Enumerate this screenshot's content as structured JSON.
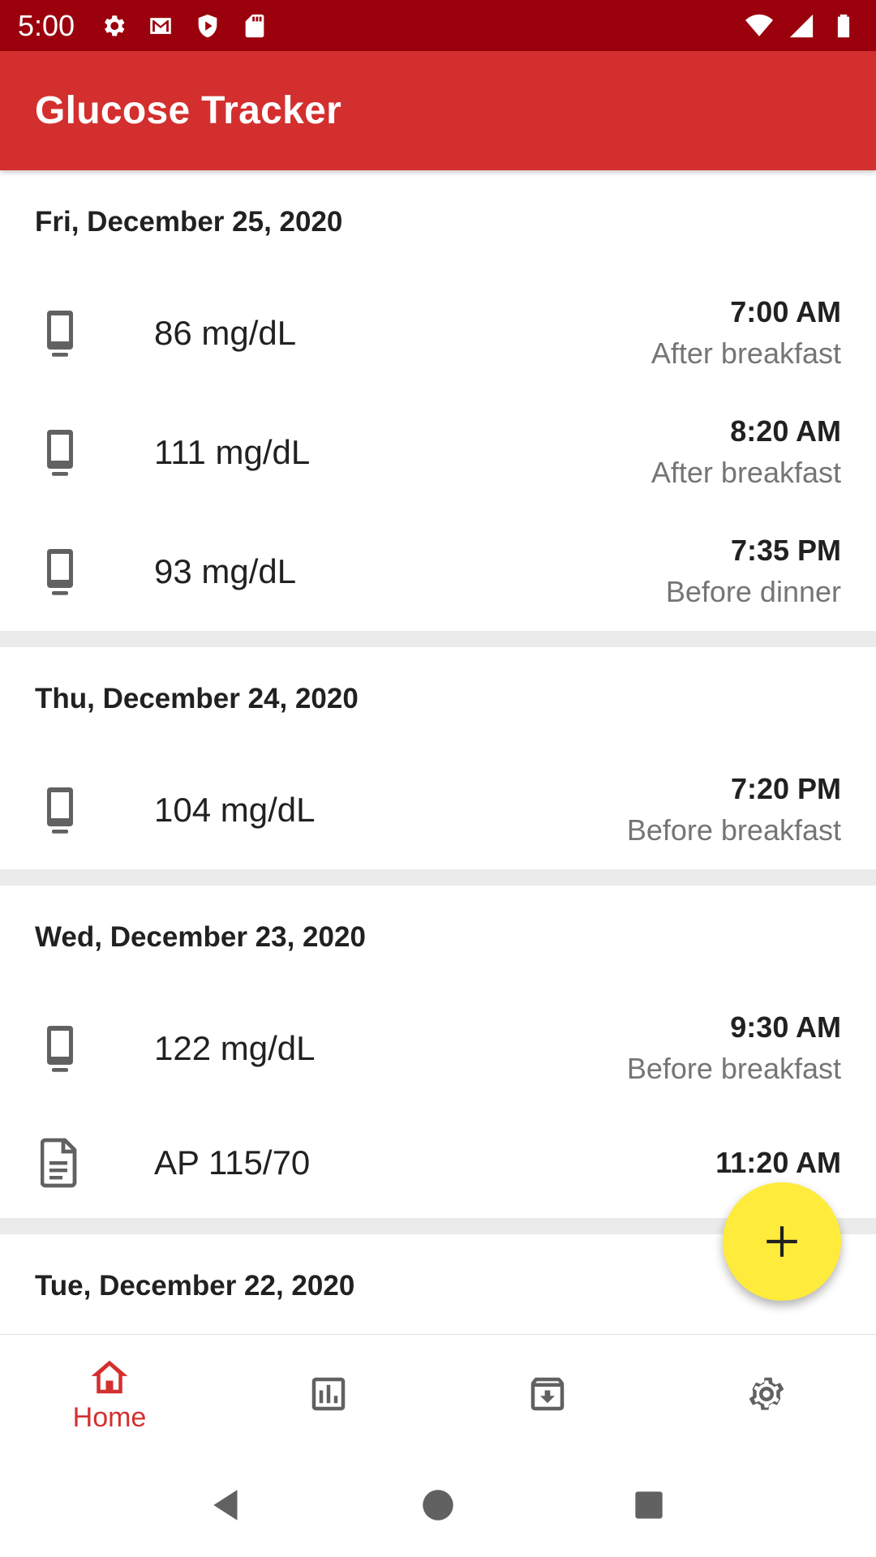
{
  "status_bar": {
    "time": "5:00",
    "left_icons": [
      "gear-icon",
      "gmail-icon",
      "shield-icon",
      "sd-card-icon"
    ],
    "right_icons": [
      "wifi-icon",
      "signal-icon",
      "battery-icon"
    ],
    "color": "#9b000d"
  },
  "app_bar": {
    "title": "Glucose Tracker",
    "color": "#d32f2f"
  },
  "days": [
    {
      "date": "Fri, December 25, 2020",
      "entries": [
        {
          "icon": "phone-icon",
          "value": "86 mg/dL",
          "time": "7:00 AM",
          "note": "After breakfast"
        },
        {
          "icon": "phone-icon",
          "value": "111 mg/dL",
          "time": "8:20 AM",
          "note": "After breakfast"
        },
        {
          "icon": "phone-icon",
          "value": "93 mg/dL",
          "time": "7:35 PM",
          "note": "Before dinner"
        }
      ]
    },
    {
      "date": "Thu, December 24, 2020",
      "entries": [
        {
          "icon": "phone-icon",
          "value": "104 mg/dL",
          "time": "7:20 PM",
          "note": "Before breakfast"
        }
      ]
    },
    {
      "date": "Wed, December 23, 2020",
      "entries": [
        {
          "icon": "phone-icon",
          "value": "122 mg/dL",
          "time": "9:30 AM",
          "note": "Before breakfast"
        },
        {
          "icon": "document-icon",
          "value": "AP 115/70",
          "time": "11:20 AM",
          "note": ""
        }
      ]
    },
    {
      "date": "Tue, December 22, 2020",
      "entries": []
    }
  ],
  "fab": {
    "icon": "plus-icon",
    "color": "#ffeb3b"
  },
  "bottom_nav": {
    "active_color": "#d32f2f",
    "items": [
      {
        "icon": "home-icon",
        "label": "Home",
        "active": true
      },
      {
        "icon": "bar-chart-icon",
        "label": "",
        "active": false
      },
      {
        "icon": "archive-icon",
        "label": "",
        "active": false
      },
      {
        "icon": "settings-icon",
        "label": "",
        "active": false
      }
    ]
  },
  "system_nav": [
    "back-icon",
    "home-circle-icon",
    "recents-icon"
  ]
}
